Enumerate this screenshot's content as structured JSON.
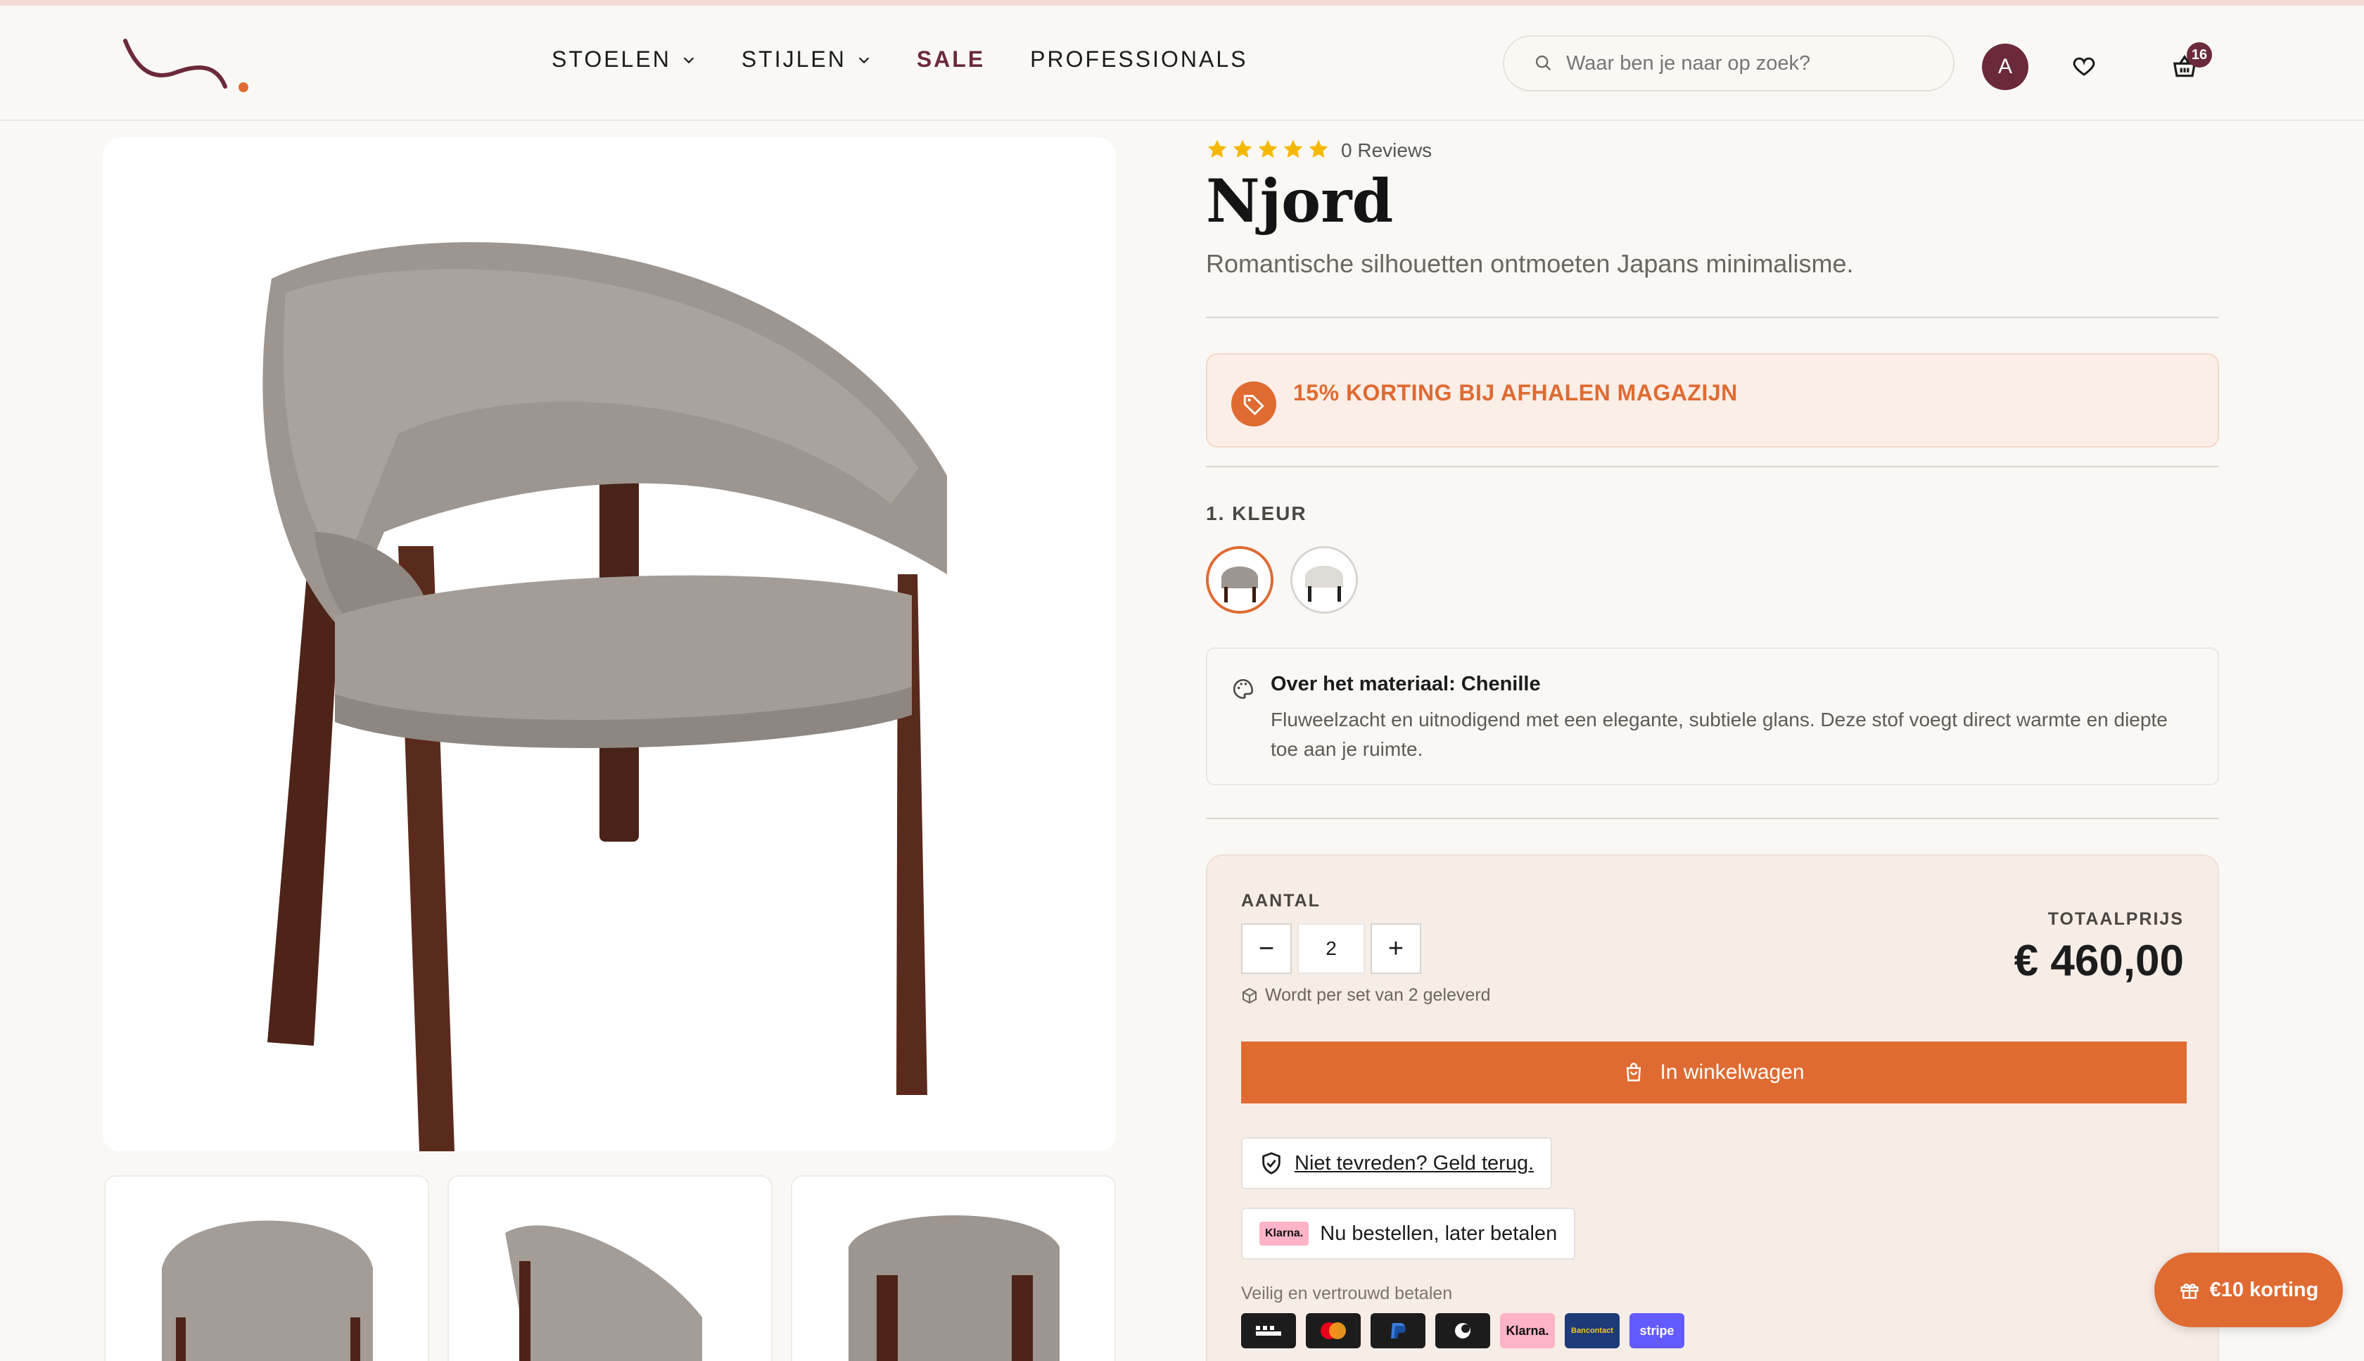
{
  "header": {
    "nav": [
      {
        "label": "STOELEN",
        "dropdown": true
      },
      {
        "label": "STIJLEN",
        "dropdown": true
      },
      {
        "label": "SALE",
        "dropdown": false
      },
      {
        "label": "PROFESSIONALS",
        "dropdown": false
      }
    ],
    "search_placeholder": "Waar ben je naar op zoek?",
    "avatar_initial": "A",
    "cart_count": "16",
    "brand_color": "#6b2a3a"
  },
  "product": {
    "rating_stars": 5,
    "reviews": "0 Reviews",
    "title": "Njord",
    "subtitle": "Romantische silhouetten ontmoeten Japans minimalisme.",
    "promo": "15% KORTING BIJ AFHALEN MAGAZIJN",
    "color_label": "1. KLEUR",
    "swatches": [
      {
        "name": "grijs",
        "selected": true
      },
      {
        "name": "wit",
        "selected": false
      }
    ],
    "material_title": "Over het materiaal: Chenille",
    "material_desc": "Fluweelzacht en uitnodigend met een elegante, subtiele glans. Deze stof voegt direct warmte en diepte toe aan je ruimte."
  },
  "buybox": {
    "qty_label": "AANTAL",
    "qty_minus": "−",
    "qty_plus": "+",
    "qty_value": "2",
    "set_note": "Wordt per set van 2 geleverd",
    "total_label": "TOTAALPRIJS",
    "total_price": "€ 460,00",
    "add_to_cart": "In winkelwagen",
    "guarantee": "Niet tevreden? Geld terug.",
    "klarna_badge": "Klarna.",
    "klarna_text": "Nu bestellen, later betalen",
    "pay_label": "Veilig en vertrouwd betalen",
    "payments": [
      {
        "name": "iDEAL",
        "label": "",
        "bg": "#1c1c1c",
        "fg": "#ffffff"
      },
      {
        "name": "Mastercard",
        "label": "",
        "bg": "#1c1c1c",
        "fg": "#ffffff"
      },
      {
        "name": "PayPal",
        "label": "",
        "bg": "#1c1c1c",
        "fg": "#ffffff"
      },
      {
        "name": "Apple Pay",
        "label": "",
        "bg": "#1c1c1c",
        "fg": "#ffffff"
      },
      {
        "name": "Klarna",
        "label": "Klarna.",
        "bg": "#ffb3c7",
        "fg": "#111111"
      },
      {
        "name": "Bancontact",
        "label": "Bancontact",
        "bg": "#1e3a78",
        "fg": "#f5c518"
      },
      {
        "name": "Stripe",
        "label": "stripe",
        "bg": "#635bff",
        "fg": "#ffffff"
      }
    ],
    "accent": "#df6b32"
  },
  "discount_button": "€10 korting"
}
